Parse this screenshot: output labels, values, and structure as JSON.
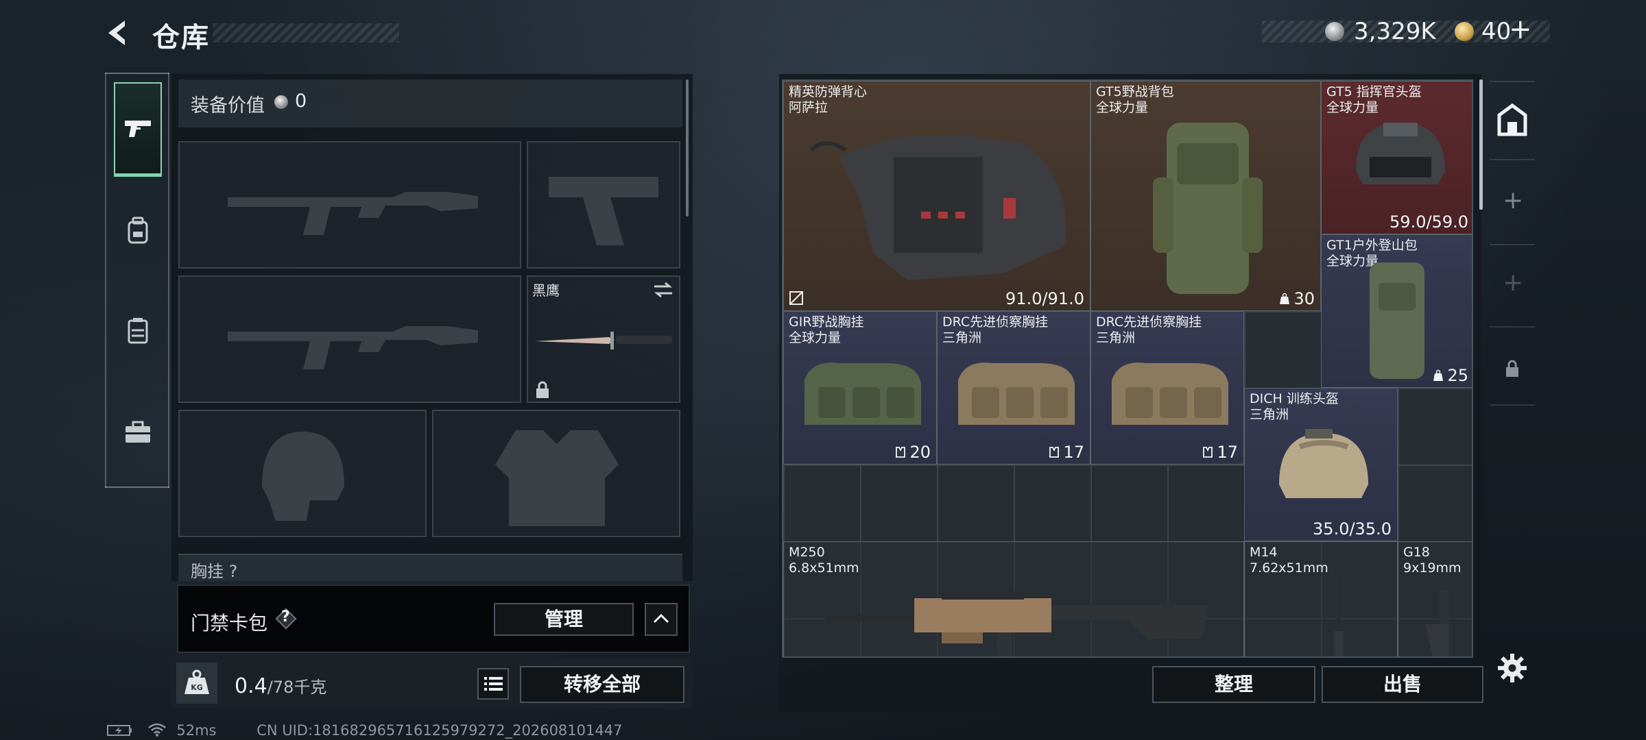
{
  "header": {
    "title": "仓库",
    "currency_silver": "3,329K",
    "currency_gold": "40",
    "add_label": "+"
  },
  "tabs": [
    {
      "icon": "pistol-icon",
      "active": true
    },
    {
      "icon": "backpack-icon",
      "active": false
    },
    {
      "icon": "vest-icon",
      "active": false
    },
    {
      "icon": "case-icon",
      "active": false
    }
  ],
  "loadout": {
    "value_label": "装备价值",
    "value": "0",
    "melee_name": "黑鹰",
    "chest_label": "胸挂",
    "chest_suffix": "?"
  },
  "keycard": {
    "label": "门禁卡包",
    "help": "?",
    "manage_label": "管理"
  },
  "weight": {
    "value": "0.4",
    "capacity": "/78千克",
    "unit_icon_text": "KG",
    "transfer_all_label": "转移全部"
  },
  "status": {
    "ping": "52ms",
    "uid": "CN UID:181682965716125979272_202608101447"
  },
  "stash": {
    "items": [
      {
        "name": "精英防弹背心",
        "sub": "阿萨拉",
        "qty": "91.0/91.0",
        "qty_icon": "",
        "rarity": "brown"
      },
      {
        "name": "GT5野战背包",
        "sub": "全球力量",
        "qty": "30",
        "qty_icon": "weight-icon",
        "rarity": "brown"
      },
      {
        "name": "GT5 指挥官头盔",
        "sub": "全球力量",
        "qty": "59.0/59.0",
        "qty_icon": "",
        "rarity": "red"
      },
      {
        "name": "GT1户外登山包",
        "sub": "全球力量",
        "qty": "25",
        "qty_icon": "weight-icon",
        "rarity": "purple"
      },
      {
        "name": "GIR野战胸挂",
        "sub": "全球力量",
        "qty": "20",
        "qty_icon": "rig-icon",
        "rarity": "purple"
      },
      {
        "name": "DRC先进侦察胸挂",
        "sub": "三角洲",
        "qty": "17",
        "qty_icon": "rig-icon",
        "rarity": "purple"
      },
      {
        "name": "DRC先进侦察胸挂",
        "sub": "三角洲",
        "qty": "17",
        "qty_icon": "rig-icon",
        "rarity": "purple"
      },
      {
        "name": "DICH 训练头盔",
        "sub": "三角洲",
        "qty": "35.0/35.0",
        "qty_icon": "",
        "rarity": "purple"
      },
      {
        "name": "M250",
        "sub": "6.8x51mm",
        "qty": "",
        "qty_icon": "",
        "rarity": "plain"
      },
      {
        "name": "M14",
        "sub": "7.62x51mm",
        "qty": "",
        "qty_icon": "",
        "rarity": "plain"
      },
      {
        "name": "G18",
        "sub": "9x19mm",
        "qty": "",
        "qty_icon": "",
        "rarity": "plain"
      }
    ],
    "sort_label": "整理",
    "sell_label": "出售",
    "side_add": "+"
  },
  "colors": {
    "accent_green": "#7fd6b0",
    "rarity_brown": "#4b3b30",
    "rarity_red": "#5c2a2e",
    "rarity_purple": "#363a52"
  }
}
